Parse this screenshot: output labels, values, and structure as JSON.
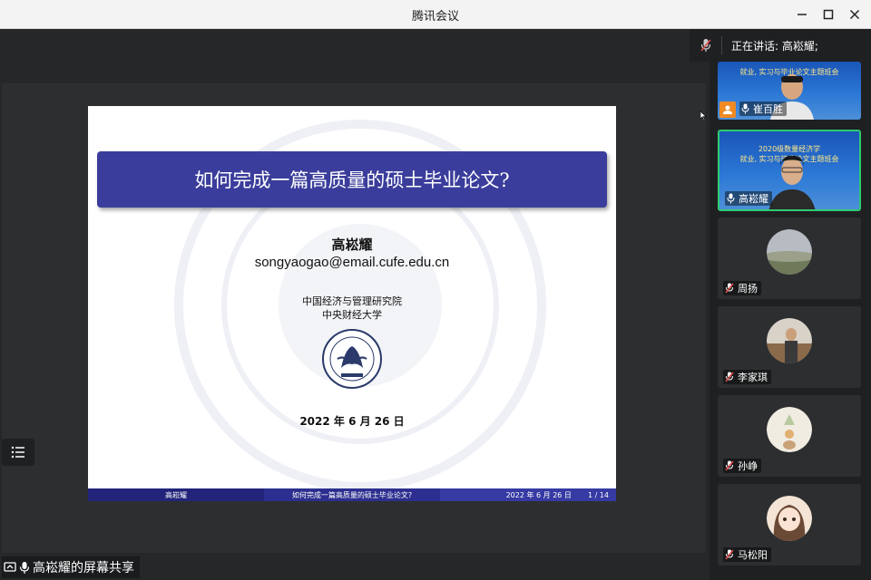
{
  "window": {
    "title": "腾讯会议",
    "controls": {
      "minimize": "—",
      "maximize": "☐",
      "close": "✕"
    }
  },
  "speaking": {
    "label": "正在讲话: 高崧耀;"
  },
  "slide": {
    "title": "如何完成一篇高质量的硕士毕业论文?",
    "author": "高崧耀",
    "email": "songyaogao@email.cufe.edu.cn",
    "institute": "中国经济与管理研究院",
    "university": "中央财经大学",
    "date": "2022 年 6 月 26 日",
    "footer": {
      "author": "高崧耀",
      "title": "如何完成一篇高质量的硕士毕业论文?",
      "date": "2022 年 6 月 26 日",
      "page": "1 / 14"
    }
  },
  "share": {
    "label": "高崧耀的屏幕共享"
  },
  "participants": [
    {
      "name": "崔百胜",
      "mic": "on",
      "host": true,
      "video": true,
      "video_line1": "就业, 实习与毕业论文主题班会",
      "video_line2": ""
    },
    {
      "name": "高崧耀",
      "mic": "on",
      "host": false,
      "video": true,
      "active": true,
      "video_line1": "2020级数量经济学",
      "video_line2": "就业, 实习与毕业论文主题班会"
    },
    {
      "name": "周扬",
      "mic": "muted",
      "video": false
    },
    {
      "name": "李家琪",
      "mic": "muted",
      "video": false
    },
    {
      "name": "孙峥",
      "mic": "muted",
      "video": false
    },
    {
      "name": "马松阳",
      "mic": "muted",
      "video": false
    }
  ],
  "colors": {
    "slide_title_bg": "#3a3d9b",
    "active_border": "#2ecc71",
    "muted_icon": "#e04848",
    "host_badge": "#f08a24"
  }
}
